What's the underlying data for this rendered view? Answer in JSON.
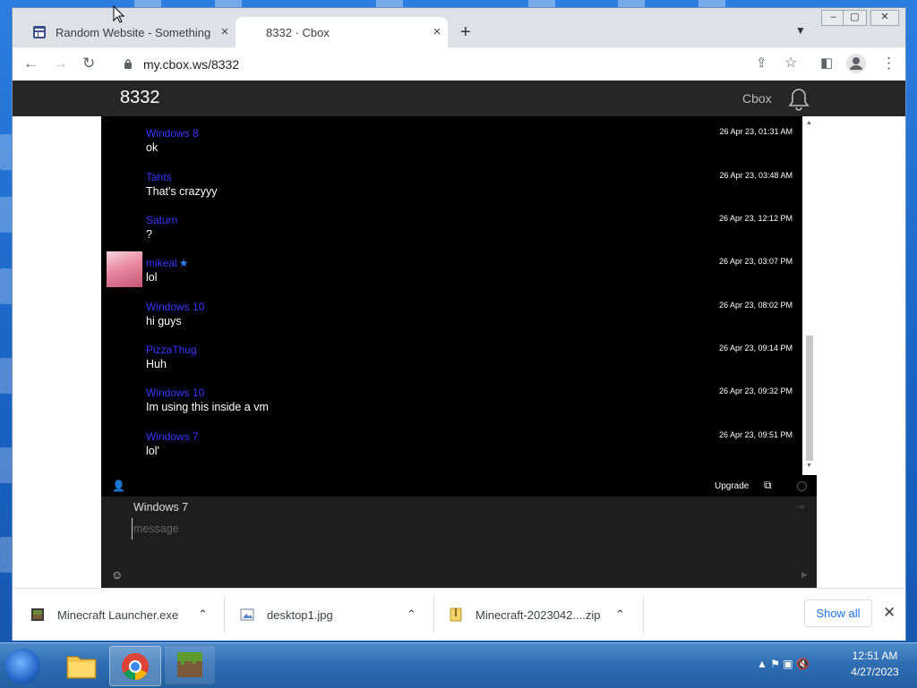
{
  "browser": {
    "tabs": [
      {
        "title": "Random Website - Something",
        "active": false
      },
      {
        "title": "8332 · Cbox",
        "active": true
      }
    ],
    "close_glyph": "×",
    "new_tab_glyph": "+",
    "url": "my.cbox.ws/8332"
  },
  "page": {
    "title": "8332",
    "brand": "Cbox",
    "messages": [
      {
        "name": "Windows 8",
        "text": "ok",
        "time": "26 Apr 23, 01:31 AM"
      },
      {
        "name": "Tahts",
        "text": "That's crazyyy",
        "time": "26 Apr 23, 03:48 AM"
      },
      {
        "name": "Saturn",
        "text": "?",
        "time": "26 Apr 23, 12:12 PM"
      },
      {
        "name": "mikeal",
        "text": "lol",
        "time": "26 Apr 23, 03:07 PM",
        "avatar": true,
        "starred": true
      },
      {
        "name": "Windows 10",
        "text": "hi guys",
        "time": "26 Apr 23, 08:02 PM"
      },
      {
        "name": "PizzaThug",
        "text": "Huh",
        "time": "26 Apr 23, 09:14 PM"
      },
      {
        "name": "Windows 10",
        "text": "Im using this inside a vm",
        "time": "26 Apr 23, 09:32 PM"
      },
      {
        "name": "Windows 7",
        "text": "lol'",
        "time": "26 Apr 23, 09:51 PM"
      }
    ],
    "upgrade_label": "Upgrade",
    "compose": {
      "username": "Windows 7",
      "placeholder": "message"
    }
  },
  "downloads": {
    "items": [
      {
        "name": "Minecraft Launcher.exe"
      },
      {
        "name": "desktop1.jpg"
      },
      {
        "name": "Minecraft-2023042....zip"
      }
    ],
    "show_all": "Show all"
  },
  "taskbar": {
    "time": "12:51 AM",
    "date": "4/27/2023"
  },
  "colors": {
    "username": "#3838ff",
    "chat_bg": "#000000",
    "header_bg": "#262626",
    "show_all": "#1a73e8"
  }
}
